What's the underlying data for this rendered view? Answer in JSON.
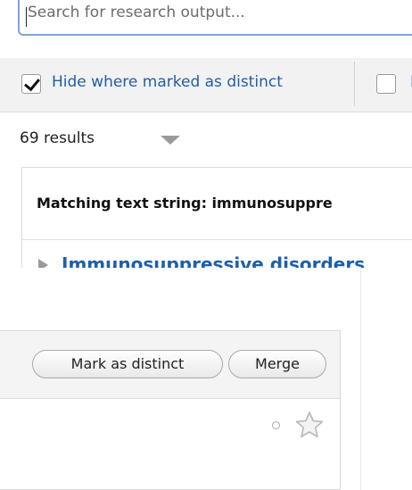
{
  "search": {
    "placeholder": "Search for research output..."
  },
  "filters": {
    "hide_distinct_label": "Hide where marked as distinct",
    "hide_distinct_checked": true,
    "second_label_partial": "I"
  },
  "results": {
    "count_label": "69 results"
  },
  "group": {
    "title": "Matching text string: immunosuppre",
    "item_label": "Immunosuppressive disorders"
  },
  "actions": {
    "mark_distinct_label": "Mark as distinct",
    "merge_label": "Merge"
  },
  "icons": {
    "sort": "chevron-down-icon",
    "expand": "triangle-right-icon",
    "status": "circle-icon",
    "favorite": "star-icon"
  },
  "colors": {
    "link": "#1f5fa8",
    "search_border": "#7aa7d6"
  }
}
